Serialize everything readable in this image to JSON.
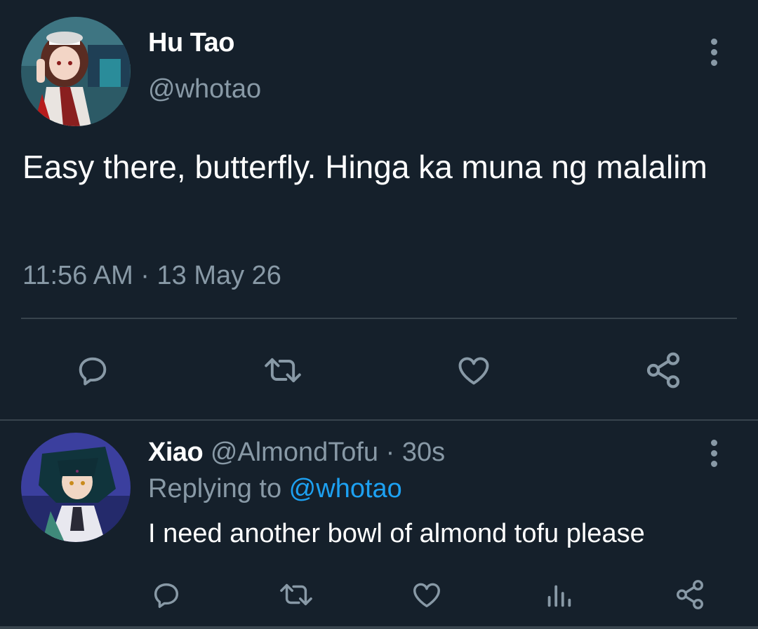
{
  "main_tweet": {
    "display_name": "Hu Tao",
    "handle": "@whotao",
    "text": "Easy there, butterfly. Hinga ka muna ng malalim",
    "timestamp": "11:56 AM · 13 May 26",
    "actions": [
      "reply-icon",
      "retweet-icon",
      "like-icon",
      "share-icon"
    ]
  },
  "reply": {
    "display_name": "Xiao",
    "handle": "@AlmondTofu",
    "separator": " · ",
    "time": "30s",
    "replying_prefix": "Replying to ",
    "replying_mention": "@whotao",
    "text": "I need another bowl of almond tofu please",
    "actions": [
      "reply-icon",
      "retweet-icon",
      "like-icon",
      "analytics-icon",
      "share-icon"
    ]
  },
  "colors": {
    "background": "#15202b",
    "primary_text": "#ffffff",
    "secondary_text": "#8899a6",
    "divider": "#38444d",
    "accent": "#1da1f2"
  }
}
